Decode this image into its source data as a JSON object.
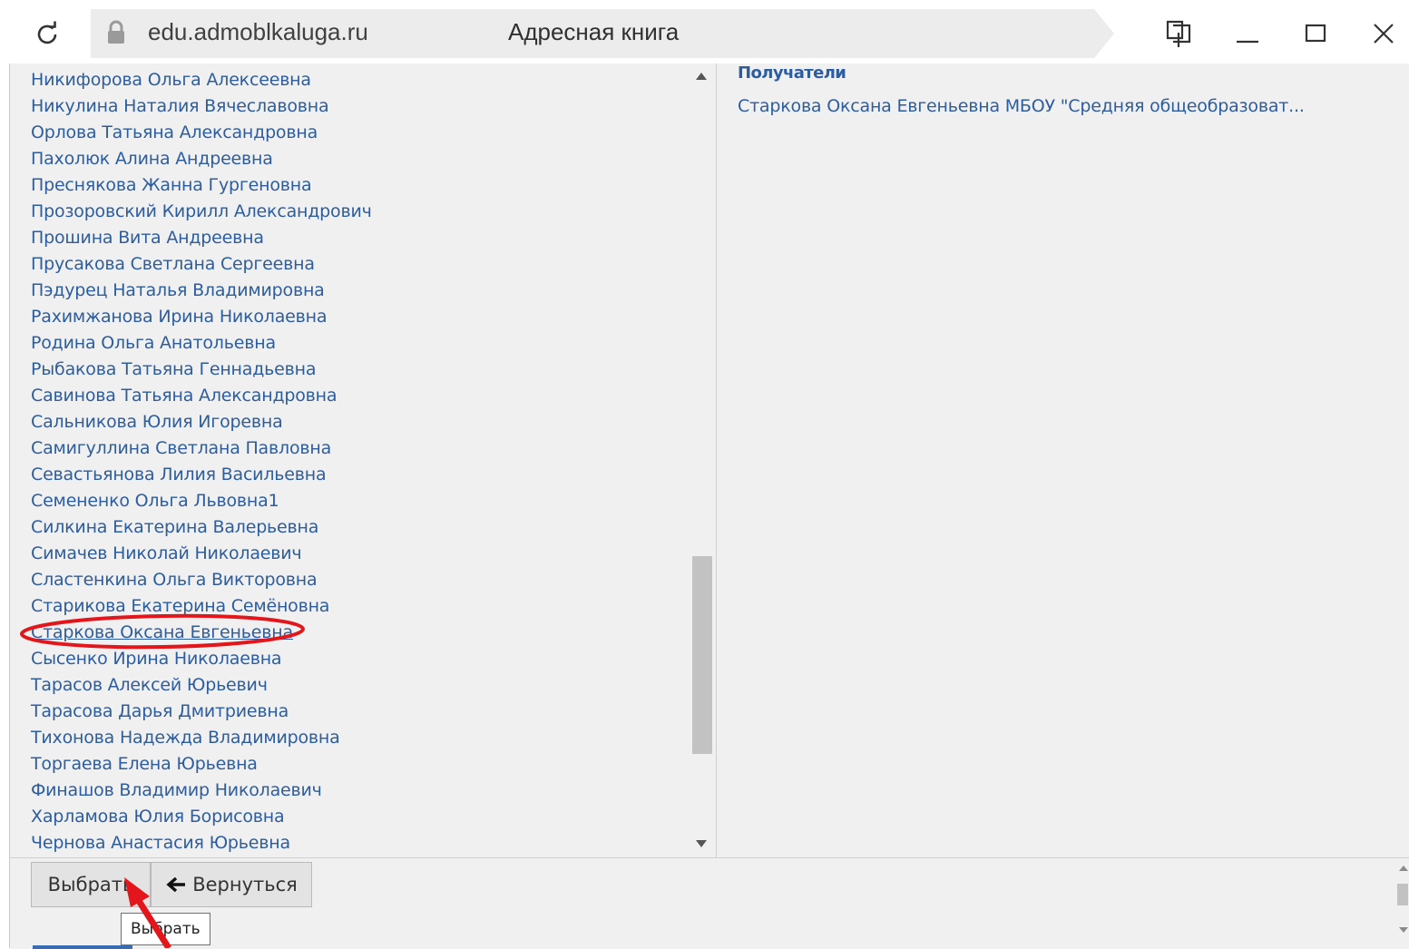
{
  "browser": {
    "url": "edu.admoblkaluga.ru",
    "page_title": "Адресная книга",
    "icons": [
      "refresh-icon",
      "lock-icon",
      "pin-icon",
      "minimize-icon",
      "maximize-icon",
      "close-icon"
    ]
  },
  "contacts": [
    "Никифорова Ольга Алексеевна",
    "Никулина Наталия Вячеславовна",
    "Орлова Татьяна Александровна",
    "Пахолюк Алина Андреевна",
    "Преснякова Жанна Гургеновна",
    "Прозоровский Кирилл Александрович",
    "Прошина Вита Андреевна",
    "Прусакова Светлана Сергеевна",
    "Пэдурец Наталья Владимировна",
    "Рахимжанова Ирина Николаевна",
    "Родина Ольга Анатольевна",
    "Рыбакова Татьяна Геннадьевна",
    "Савинова Татьяна Александровна",
    "Сальникова Юлия Игоревна",
    "Самигуллина Светлана Павловна",
    "Севастьянова Лилия Васильевна",
    "Семененко Ольга Львовна1",
    "Силкина Екатерина Валерьевна",
    "Симачев Николай Николаевич",
    "Сластенкина Ольга Викторовна",
    "Старикова Екатерина Семёновна",
    "Старкова Оксана Евгеньевна",
    "Сысенко Ирина Николаевна",
    "Тарасов Алексей Юрьевич",
    "Тарасова Дарья Дмитриевна",
    "Тихонова Надежда Владимировна",
    "Торгаева Елена Юрьевна",
    "Финашов Владимир Николаевич",
    "Харламова Юлия Борисовна",
    "Чернова Анастасия Юрьевна"
  ],
  "highlighted_contact_index": 21,
  "recipients": {
    "title": "Получатели",
    "items": [
      "Старкова Оксана Евгеньевна МБОУ \"Средняя общеобразоват..."
    ]
  },
  "footer": {
    "select_label": "Выбрать",
    "back_label": "Вернуться",
    "back_icon": "arrow-left-icon",
    "tooltip": "Выбрать"
  },
  "annotation_color": "#e3161b",
  "link_color": "#2d5d9e"
}
